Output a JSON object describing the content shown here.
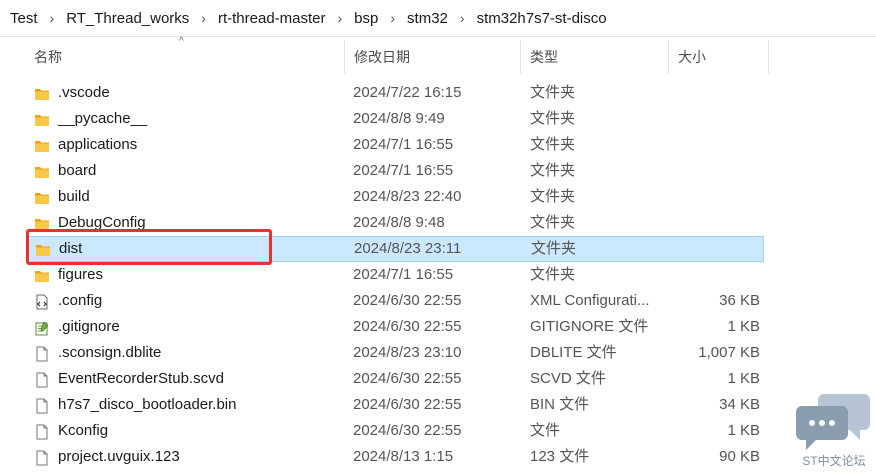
{
  "breadcrumb": [
    "Test",
    "RT_Thread_works",
    "rt-thread-master",
    "bsp",
    "stm32",
    "stm32h7s7-st-disco"
  ],
  "breadcrumb_separator": "›",
  "columns": {
    "name": "名称",
    "date": "修改日期",
    "type": "类型",
    "size": "大小"
  },
  "sort_indicator": "^",
  "files": [
    {
      "icon": "folder-icon",
      "name": ".vscode",
      "date": "2024/7/22 16:15",
      "type": "文件夹",
      "size": ""
    },
    {
      "icon": "folder-icon",
      "name": "__pycache__",
      "date": "2024/8/8 9:49",
      "type": "文件夹",
      "size": ""
    },
    {
      "icon": "folder-icon",
      "name": "applications",
      "date": "2024/7/1 16:55",
      "type": "文件夹",
      "size": ""
    },
    {
      "icon": "folder-icon",
      "name": "board",
      "date": "2024/7/1 16:55",
      "type": "文件夹",
      "size": ""
    },
    {
      "icon": "folder-icon",
      "name": "build",
      "date": "2024/8/23 22:40",
      "type": "文件夹",
      "size": ""
    },
    {
      "icon": "folder-icon",
      "name": "DebugConfig",
      "date": "2024/8/8 9:48",
      "type": "文件夹",
      "size": ""
    },
    {
      "icon": "folder-icon",
      "name": "dist",
      "date": "2024/8/23 23:11",
      "type": "文件夹",
      "size": "",
      "selected": true
    },
    {
      "icon": "folder-icon",
      "name": "figures",
      "date": "2024/7/1 16:55",
      "type": "文件夹",
      "size": ""
    },
    {
      "icon": "xml-file-icon",
      "name": ".config",
      "date": "2024/6/30 22:55",
      "type": "XML Configurati...",
      "size": "36 KB"
    },
    {
      "icon": "notepad-file-icon",
      "name": ".gitignore",
      "date": "2024/6/30 22:55",
      "type": "GITIGNORE 文件",
      "size": "1 KB"
    },
    {
      "icon": "file-icon",
      "name": ".sconsign.dblite",
      "date": "2024/8/23 23:10",
      "type": "DBLITE 文件",
      "size": "1,007 KB"
    },
    {
      "icon": "file-icon",
      "name": "EventRecorderStub.scvd",
      "date": "2024/6/30 22:55",
      "type": "SCVD 文件",
      "size": "1 KB"
    },
    {
      "icon": "file-icon",
      "name": "h7s7_disco_bootloader.bin",
      "date": "2024/6/30 22:55",
      "type": "BIN 文件",
      "size": "34 KB"
    },
    {
      "icon": "file-icon",
      "name": "Kconfig",
      "date": "2024/6/30 22:55",
      "type": "文件",
      "size": "1 KB"
    },
    {
      "icon": "file-icon",
      "name": "project.uvguix.123",
      "date": "2024/8/13 1:15",
      "type": "123 文件",
      "size": "90 KB"
    }
  ],
  "watermark": {
    "text": "ST中文论坛"
  },
  "colors": {
    "selection_bg": "#cce8ff",
    "selection_border": "#99d1ff",
    "highlight_box": "#e8322e",
    "folder": "#f0b941"
  }
}
